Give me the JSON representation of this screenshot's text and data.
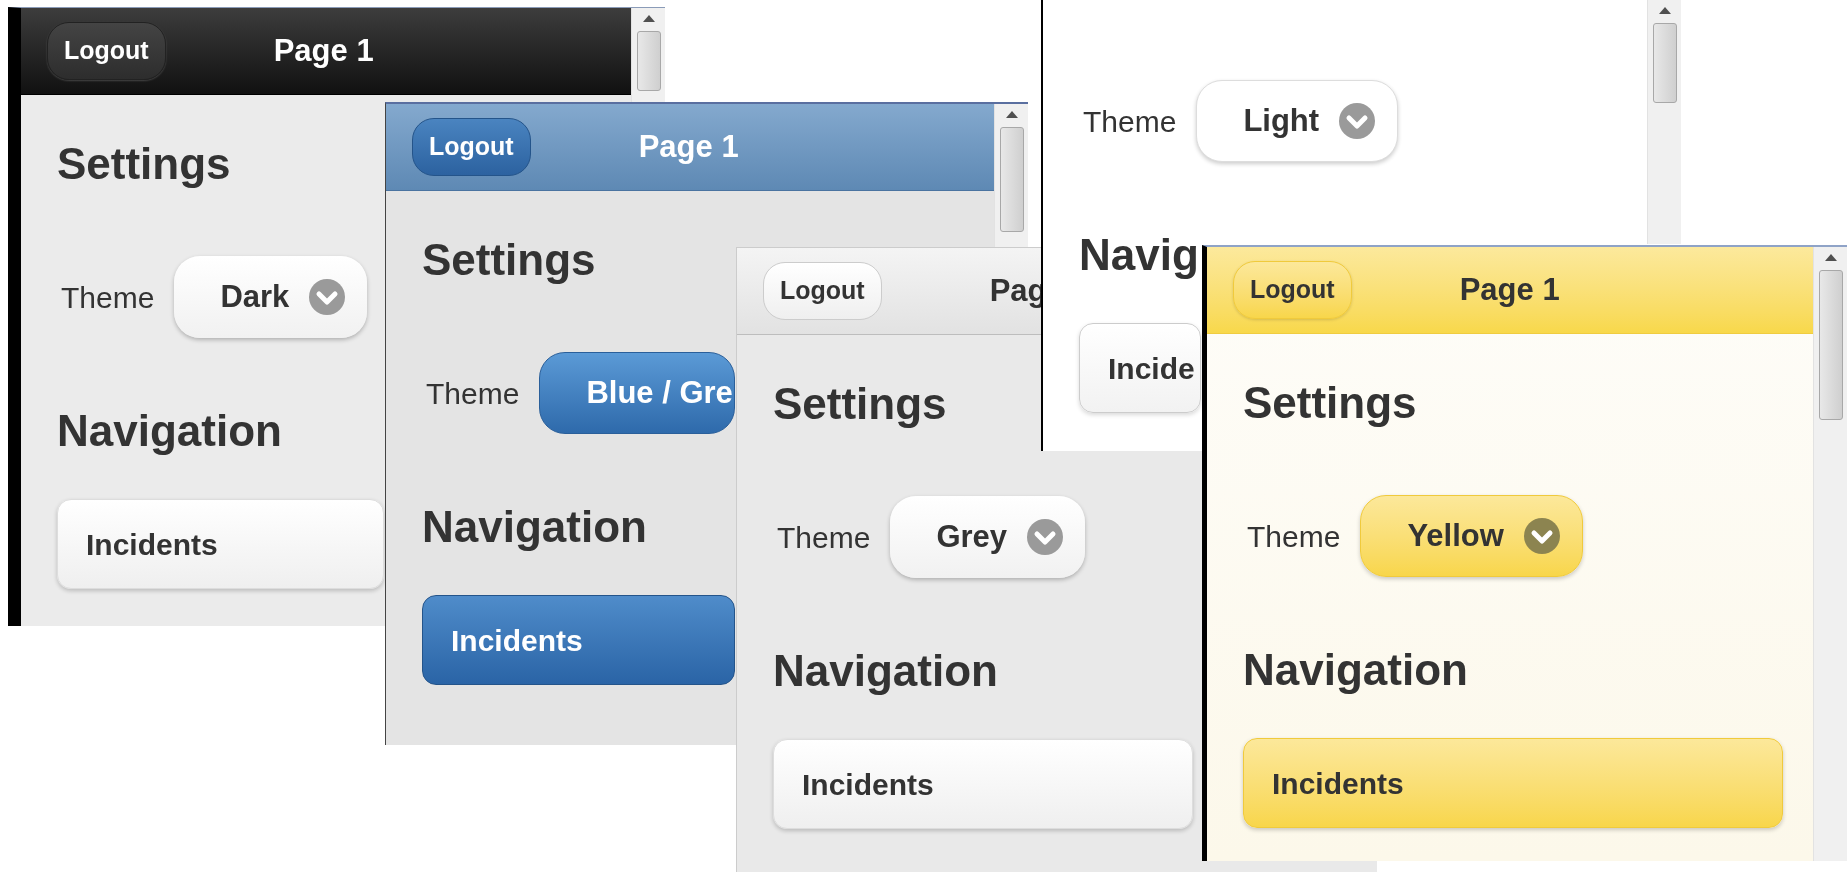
{
  "windows": [
    {
      "kind": "dark",
      "header": {
        "logout": "Logout",
        "title": "Page 1"
      },
      "settings_heading": "Settings",
      "theme_label": "Theme",
      "theme_value": "Dark",
      "nav_heading": "Navigation",
      "nav_item": "Incidents"
    },
    {
      "kind": "blue",
      "header": {
        "logout": "Logout",
        "title": "Page 1"
      },
      "settings_heading": "Settings",
      "theme_label": "Theme",
      "theme_value": "Blue / Gre",
      "nav_heading": "Navigation",
      "nav_item": "Incidents"
    },
    {
      "kind": "grey",
      "header": {
        "logout": "Logout",
        "title": "Pag"
      },
      "settings_heading": "Settings",
      "theme_label": "Theme",
      "theme_value": "Grey",
      "nav_heading": "Navigation",
      "nav_item": "Incidents"
    },
    {
      "kind": "light",
      "theme_label": "Theme",
      "theme_value": "Light",
      "nav_heading": "Navig",
      "nav_item": "Incide"
    },
    {
      "kind": "yellow",
      "header": {
        "logout": "Logout",
        "title": "Page 1"
      },
      "settings_heading": "Settings",
      "theme_label": "Theme",
      "theme_value": "Yellow",
      "nav_heading": "Navigation",
      "nav_item": "Incidents"
    }
  ]
}
